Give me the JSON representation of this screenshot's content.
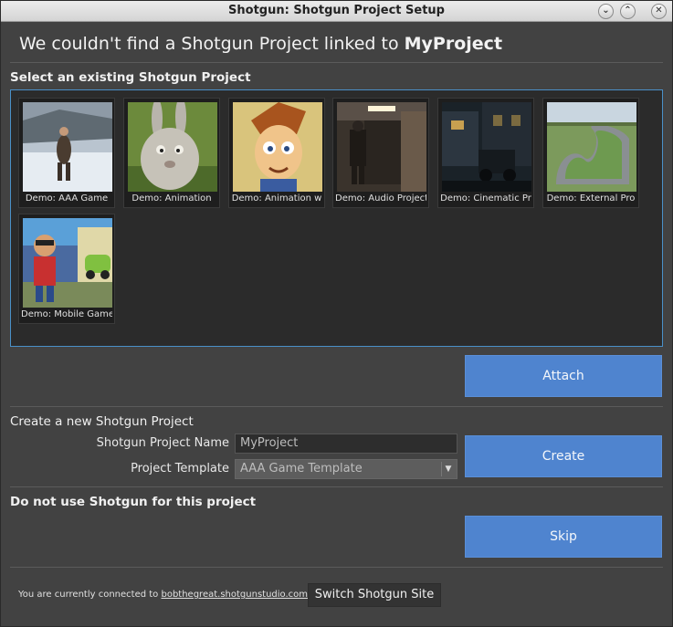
{
  "window": {
    "title": "Shotgun: Shotgun Project Setup",
    "controls": [
      "minimize",
      "maximize",
      "close"
    ]
  },
  "heading": {
    "prefix": "We couldn't find a Shotgun Project linked to ",
    "project": "MyProject"
  },
  "existing": {
    "label": "Select an existing Shotgun Project",
    "projects": [
      {
        "label": "Demo: AAA Game",
        "icon": "aaa-game-thumbnail"
      },
      {
        "label": "Demo: Animation",
        "icon": "animation-thumbnail"
      },
      {
        "label": "Demo: Animation w",
        "icon": "animation-w-thumbnail"
      },
      {
        "label": "Demo: Audio Project",
        "icon": "audio-project-thumbnail"
      },
      {
        "label": "Demo: Cinematic Pr",
        "icon": "cinematic-thumbnail"
      },
      {
        "label": "Demo: External Pro",
        "icon": "external-thumbnail"
      },
      {
        "label": "Demo: Mobile Game",
        "icon": "mobile-game-thumbnail"
      }
    ],
    "attach_label": "Attach"
  },
  "create": {
    "label": "Create a new Shotgun Project",
    "name_label": "Shotgun Project Name",
    "name_value": "MyProject",
    "template_label": "Project Template",
    "template_value": "AAA Game Template",
    "create_label": "Create"
  },
  "skip": {
    "label": "Do not use Shotgun for this project",
    "skip_label": "Skip"
  },
  "footer": {
    "prefix": "You are currently connected to ",
    "site": "bobthegreat.shotgunstudio.com",
    "suffix": ".",
    "switch_label": "Switch Shotgun Site"
  },
  "colors": {
    "accent": "#4f84cf",
    "background": "#424242",
    "grid_border": "#4a90c8"
  }
}
